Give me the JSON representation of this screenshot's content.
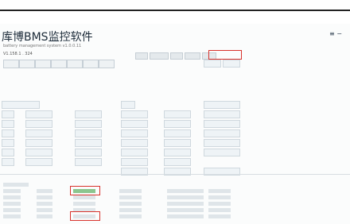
{
  "app": {
    "title": "库博BMS监控软件",
    "subtitle": "battery management system v1.0.0.11",
    "version_fragment": "V1.158.1 . 324"
  },
  "colors": {
    "highlight": "#d8322c",
    "panel": "#eef3f6"
  }
}
